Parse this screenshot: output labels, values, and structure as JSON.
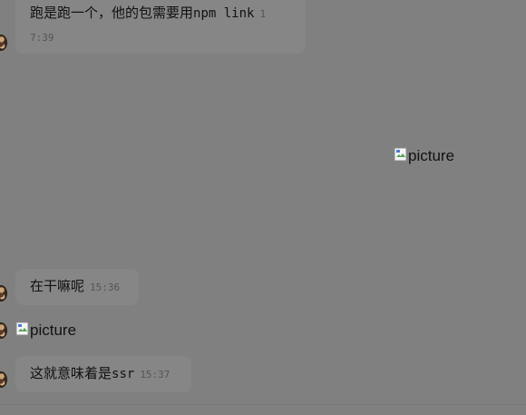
{
  "messages": [
    {
      "text_prefix": "跑是跑一个，他的包需要用",
      "text_code": "npm link",
      "time_part1": "1",
      "time_part2": "7:39"
    },
    {
      "text": "在干嘛呢",
      "time": "15:36"
    },
    {
      "text_prefix": "这就意味着是",
      "text_code": "ssr",
      "time": "15:37"
    }
  ],
  "images": [
    {
      "alt": "picture"
    },
    {
      "alt": "picture"
    }
  ]
}
